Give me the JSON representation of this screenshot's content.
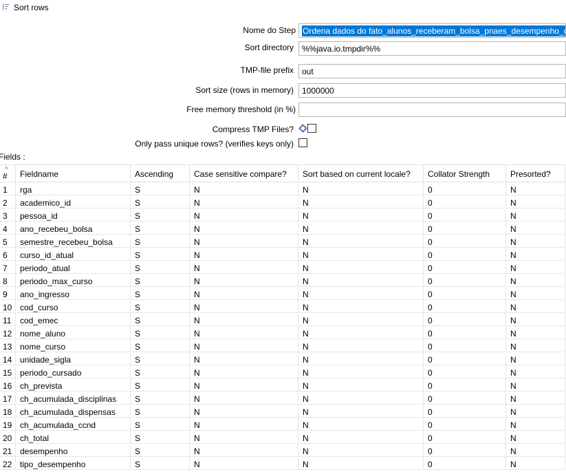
{
  "window": {
    "title": "Sort rows",
    "icon": "sort-rows-icon"
  },
  "form": {
    "step_name_label": "Nome do Step",
    "step_name_value": "Ordena dados do fato_alunos_receberam_bolsa_pnaes_desempenho_ch",
    "sort_directory_label": "Sort directory",
    "sort_directory_value": "%%java.io.tmpdir%%",
    "tmp_prefix_label": "TMP-file prefix",
    "tmp_prefix_value": "out",
    "sort_size_label": "Sort size (rows in memory)",
    "sort_size_value": "1000000",
    "free_memory_label": "Free memory threshold (in %)",
    "free_memory_value": "",
    "compress_label": "Compress TMP Files?",
    "compress_checked": false,
    "unique_label": "Only pass unique rows? (verifies keys only)",
    "unique_checked": false
  },
  "fields": {
    "label": "Fields :",
    "columns": [
      "#",
      "Fieldname",
      "Ascending",
      "Case sensitive compare?",
      "Sort based on current locale?",
      "Collator Strength",
      "Presorted?"
    ],
    "rows": [
      [
        "1",
        "rga",
        "S",
        "N",
        "N",
        "0",
        "N"
      ],
      [
        "2",
        "academico_id",
        "S",
        "N",
        "N",
        "0",
        "N"
      ],
      [
        "3",
        "pessoa_id",
        "S",
        "N",
        "N",
        "0",
        "N"
      ],
      [
        "4",
        "ano_recebeu_bolsa",
        "S",
        "N",
        "N",
        "0",
        "N"
      ],
      [
        "5",
        "semestre_recebeu_bolsa",
        "S",
        "N",
        "N",
        "0",
        "N"
      ],
      [
        "6",
        "curso_id_atual",
        "S",
        "N",
        "N",
        "0",
        "N"
      ],
      [
        "7",
        "periodo_atual",
        "S",
        "N",
        "N",
        "0",
        "N"
      ],
      [
        "8",
        "periodo_max_curso",
        "S",
        "N",
        "N",
        "0",
        "N"
      ],
      [
        "9",
        "ano_ingresso",
        "S",
        "N",
        "N",
        "0",
        "N"
      ],
      [
        "10",
        "cod_curso",
        "S",
        "N",
        "N",
        "0",
        "N"
      ],
      [
        "11",
        "cod_emec",
        "S",
        "N",
        "N",
        "0",
        "N"
      ],
      [
        "12",
        "nome_aluno",
        "S",
        "N",
        "N",
        "0",
        "N"
      ],
      [
        "13",
        "nome_curso",
        "S",
        "N",
        "N",
        "0",
        "N"
      ],
      [
        "14",
        "unidade_sigla",
        "S",
        "N",
        "N",
        "0",
        "N"
      ],
      [
        "15",
        "periodo_cursado",
        "S",
        "N",
        "N",
        "0",
        "N"
      ],
      [
        "16",
        "ch_prevista",
        "S",
        "N",
        "N",
        "0",
        "N"
      ],
      [
        "17",
        "ch_acumulada_disciplinas",
        "S",
        "N",
        "N",
        "0",
        "N"
      ],
      [
        "18",
        "ch_acumulada_dispensas",
        "S",
        "N",
        "N",
        "0",
        "N"
      ],
      [
        "19",
        "ch_acumulada_ccnd",
        "S",
        "N",
        "N",
        "0",
        "N"
      ],
      [
        "20",
        "ch_total",
        "S",
        "N",
        "N",
        "0",
        "N"
      ],
      [
        "21",
        "desempenho",
        "S",
        "N",
        "N",
        "0",
        "N"
      ],
      [
        "22",
        "tipo_desempenho",
        "S",
        "N",
        "N",
        "0",
        "N"
      ]
    ]
  }
}
